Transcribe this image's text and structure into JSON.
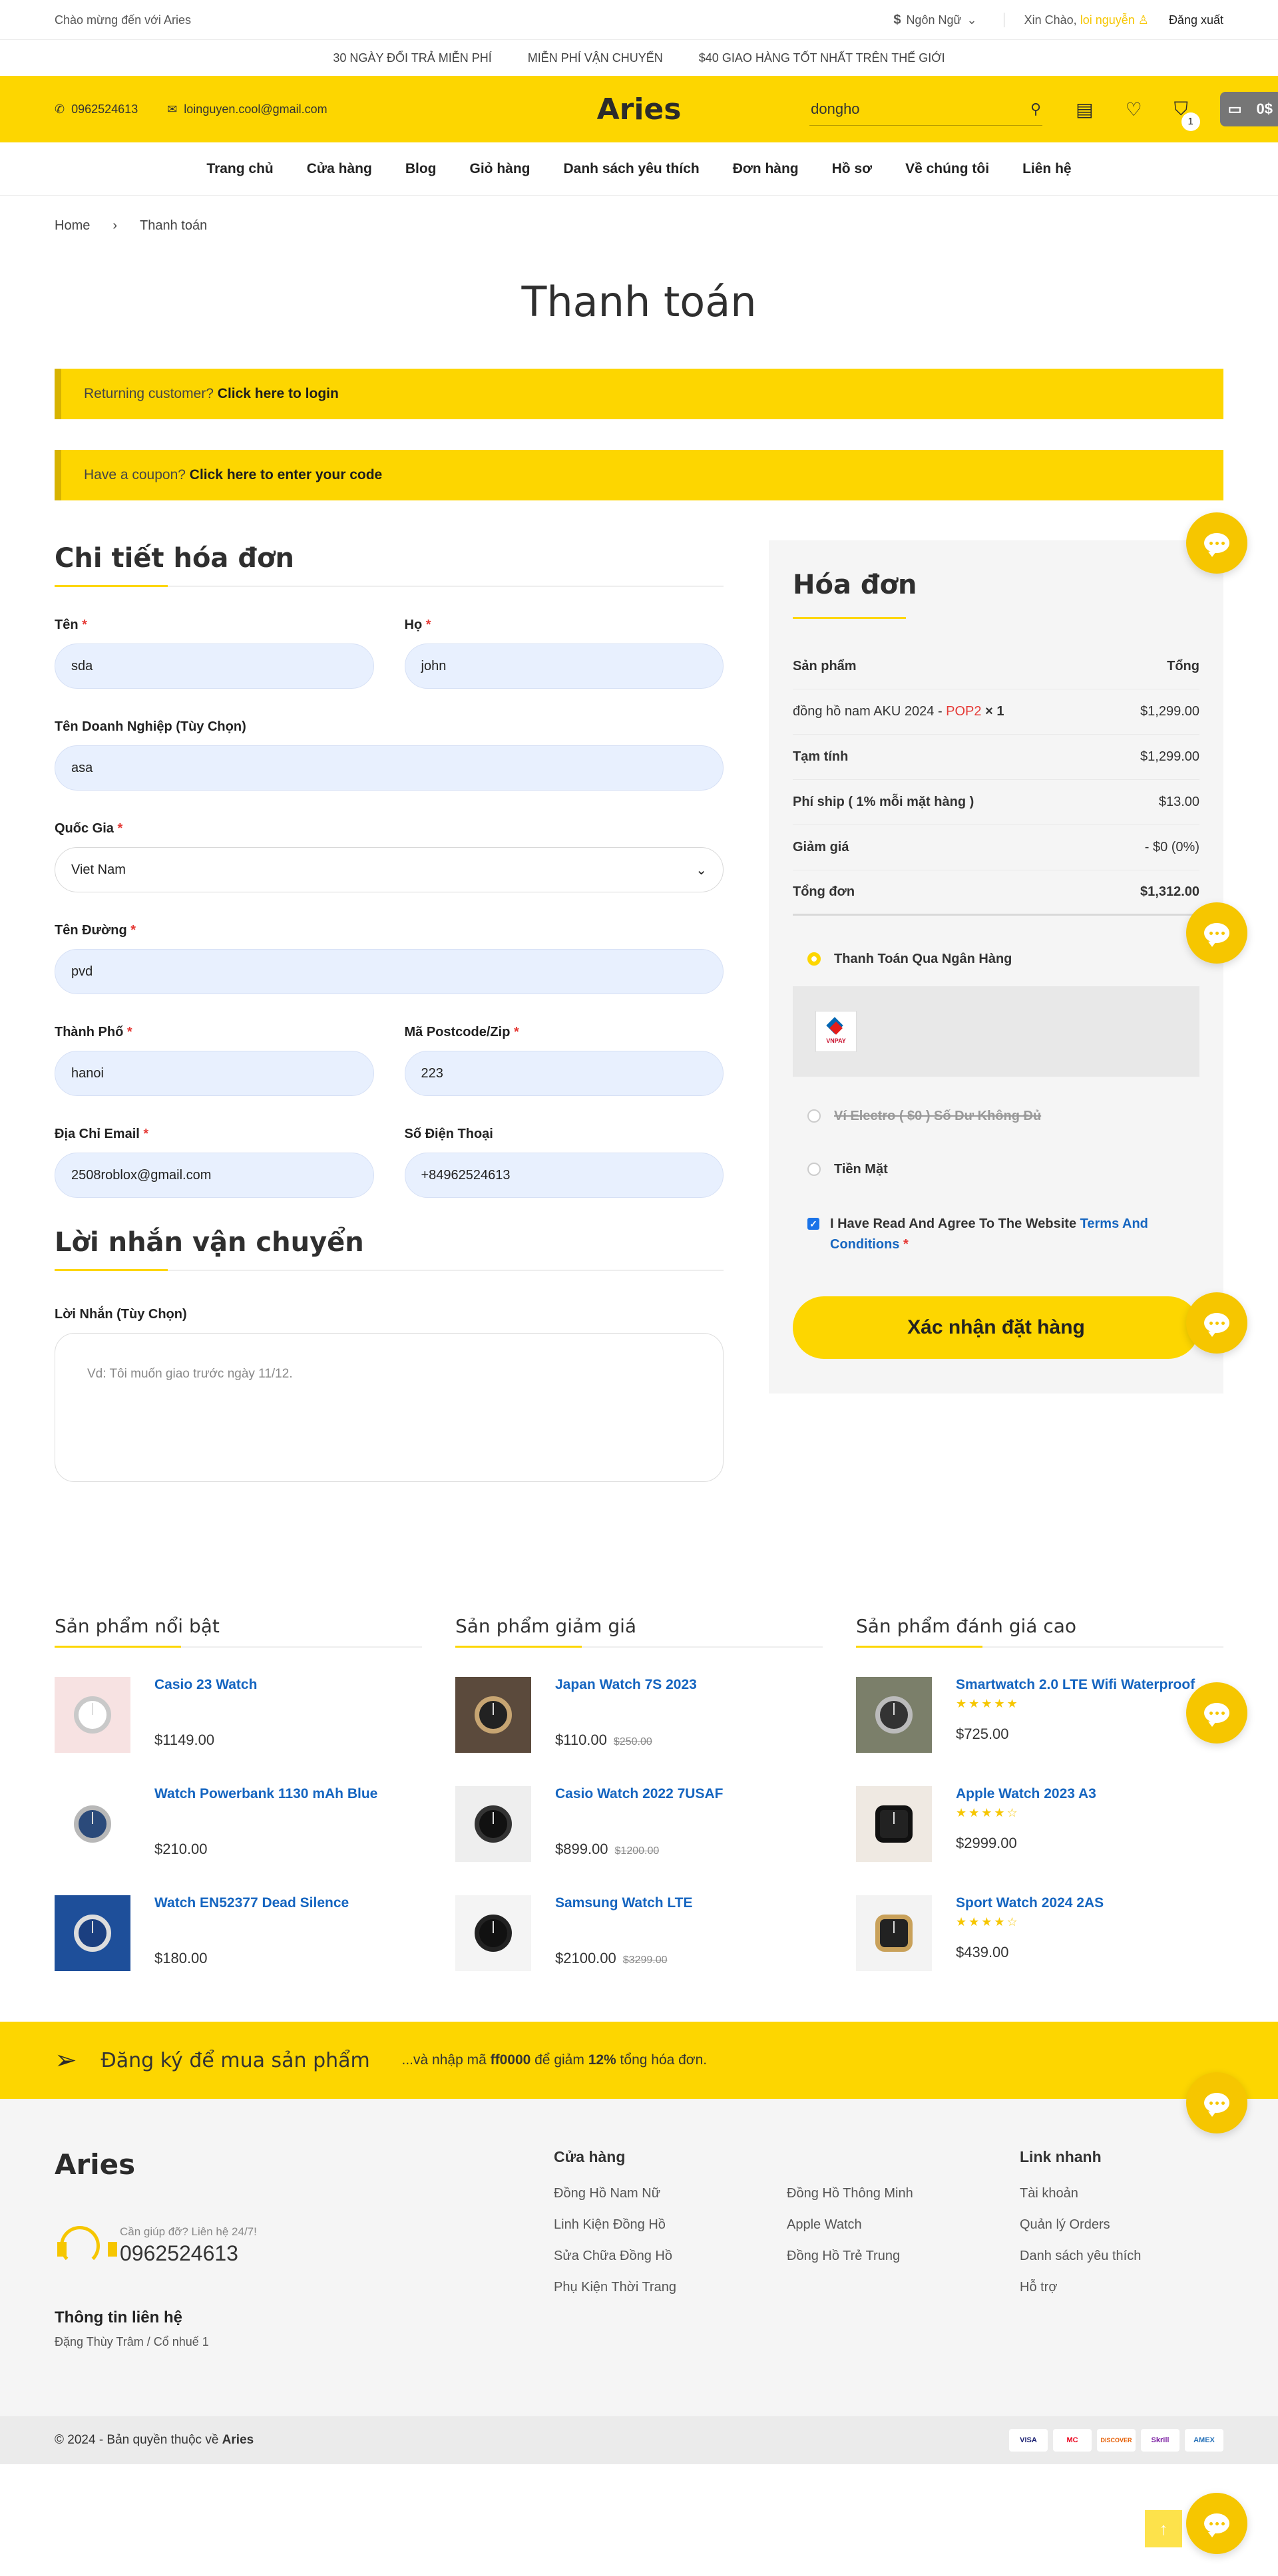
{
  "topbar": {
    "welcome": "Chào mừng đến với Aries",
    "currency_symbol": "$",
    "language": "Ngôn Ngữ",
    "hello": "Xin Chào,",
    "username": "loi nguyễn",
    "logout": "Đăng xuất"
  },
  "promo": [
    "30 NGÀY ĐỔI TRẢ MIỄN PHÍ",
    "MIỄN PHÍ VẬN CHUYỂN",
    "$40 GIAO HÀNG TỐT NHẤT TRÊN THẾ GIỚI"
  ],
  "header": {
    "phone": "0962524613",
    "email": "loinguyen.cool@gmail.com",
    "logo": "Aries",
    "search_value": "dongho",
    "cart_count": "1",
    "wallet": "0$"
  },
  "nav": [
    "Trang chủ",
    "Cửa hàng",
    "Blog",
    "Giỏ hàng",
    "Danh sách yêu thích",
    "Đơn hàng",
    "Hồ sơ",
    "Về chúng tôi",
    "Liên hệ"
  ],
  "breadcrumb": {
    "home": "Home",
    "sep": "›",
    "current": "Thanh toán"
  },
  "page_title": "Thanh toán",
  "notices": {
    "login_prefix": "Returning customer?",
    "login_link": "Click here to login",
    "coupon_prefix": "Have a coupon?",
    "coupon_link": "Click here to enter your code"
  },
  "billing": {
    "title": "Chi tiết hóa đơn",
    "first_name": {
      "label": "Tên",
      "value": "sda"
    },
    "last_name": {
      "label": "Họ",
      "value": "john"
    },
    "company": {
      "label": "Tên Doanh Nghiệp (Tùy Chọn)",
      "value": "asa"
    },
    "country": {
      "label": "Quốc Gia",
      "value": "Viet Nam"
    },
    "street": {
      "label": "Tên Đường",
      "value": "pvd"
    },
    "city": {
      "label": "Thành Phố",
      "value": "hanoi"
    },
    "postcode": {
      "label": "Mã Postcode/Zip",
      "value": "223"
    },
    "email": {
      "label": "Địa Chỉ Email",
      "value": "2508roblox@gmail.com"
    },
    "phone": {
      "label": "Số Điện Thoại",
      "value": "+84962524613"
    },
    "req": "*"
  },
  "shipping_note": {
    "title": "Lời nhắn vận chuyển",
    "label": "Lời Nhắn (Tùy Chọn)",
    "placeholder": "Vd: Tôi muốn giao trước ngày 11/12."
  },
  "order": {
    "title": "Hóa đơn",
    "col_product": "Sản phẩm",
    "col_total": "Tổng",
    "item_name": "đồng hồ nam AKU 2024 - ",
    "item_variant": "POP2",
    "item_qty": "× 1",
    "item_total": "$1,299.00",
    "subtotal_label": "Tạm tính",
    "subtotal": "$1,299.00",
    "ship_label": "Phí ship ( 1% mỗi mặt hàng )",
    "ship": "$13.00",
    "discount_label": "Giảm giá",
    "discount": "- $0 (0%)",
    "total_label": "Tổng đơn",
    "total": "$1,312.00",
    "pay_bank": "Thanh Toán Qua Ngân Hàng",
    "vnpay_logo": "VNPAY",
    "pay_wallet": "Ví Electro ( $0 ) Số Dư Không Đủ",
    "pay_cash": "Tiền Mặt",
    "agree_text": "I Have Read And Agree To The Website",
    "agree_link": "Terms And Conditions",
    "confirm": "Xác nhận đặt hàng"
  },
  "products": {
    "featured": {
      "title": "Sản phẩm nổi bật",
      "items": [
        {
          "name": "Casio 23 Watch",
          "price": "$1149.00"
        },
        {
          "name": "Watch Powerbank 1130 mAh Blue",
          "price": "$210.00"
        },
        {
          "name": "Watch EN52377 Dead Silence",
          "price": "$180.00"
        }
      ]
    },
    "sale": {
      "title": "Sản phẩm giảm giá",
      "items": [
        {
          "name": "Japan Watch 7S 2023",
          "price": "$110.00",
          "old": "$250.00"
        },
        {
          "name": "Casio Watch 2022 7USAF",
          "price": "$899.00",
          "old": "$1200.00"
        },
        {
          "name": "Samsung Watch LTE",
          "price": "$2100.00",
          "old": "$3299.00"
        }
      ]
    },
    "rated": {
      "title": "Sản phẩm đánh giá cao",
      "items": [
        {
          "name": "Smartwatch 2.0 LTE Wifi Waterproof",
          "stars": "★★★★★",
          "price": "$725.00"
        },
        {
          "name": "Apple Watch 2023 A3",
          "stars": "★★★★☆",
          "price": "$2999.00"
        },
        {
          "name": "Sport Watch 2024 2AS",
          "stars": "★★★★☆",
          "price": "$439.00"
        }
      ]
    }
  },
  "subscribe": {
    "title": "Đăng ký để mua sản phẩm",
    "desc_prefix": "...và nhập mã ",
    "code": "ff0000",
    "desc_mid": " để giảm ",
    "percent": "12%",
    "desc_suffix": " tổng hóa đơn."
  },
  "footer": {
    "logo": "Aries",
    "help": "Cần giúp đỡ? Liên hệ 24/7!",
    "phone": "0962524613",
    "info_title": "Thông tin liên hệ",
    "address": "Đặng Thùy Trâm / Cổ nhuế 1",
    "shop_title": "Cửa hàng",
    "shop_col1": [
      "Đồng Hồ Nam Nữ",
      "Linh Kiện Đồng Hồ",
      "Sửa Chữa Đồng Hồ",
      "Phụ Kiện Thời Trang"
    ],
    "shop_col2": [
      "Đồng Hồ Thông Minh",
      "Apple Watch",
      "Đồng Hồ Trẻ Trung"
    ],
    "links_title": "Link nhanh",
    "links": [
      "Tài khoản",
      "Quản lý Orders",
      "Danh sách yêu thích",
      "Hỗ trợ"
    ],
    "copyright_prefix": "© 2024 - Bản quyền thuộc về ",
    "copyright_brand": "Aries",
    "cards": [
      "VISA",
      "MC",
      "DISCOVER",
      "Skrill",
      "AMEX"
    ]
  },
  "colors": {
    "accent": "#fdd600",
    "link": "#1565c0",
    "required": "#e53935"
  }
}
